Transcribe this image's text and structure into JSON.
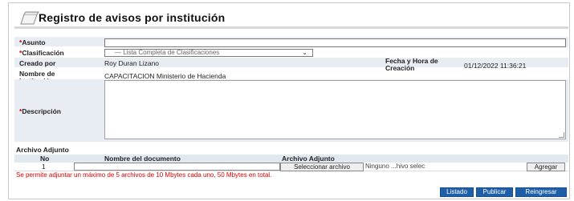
{
  "header": {
    "title": "Registro de avisos por institución"
  },
  "form": {
    "asunto_label": "Asunto",
    "clasificacion_label": "Clasificación",
    "clasificacion_selected": "— Lista Completa de Clasificaciones",
    "creado_label": "Creado por",
    "creado_value": "Roy Duran Lizano",
    "fecha_label": "Fecha y Hora de Creación",
    "fecha_value": "01/12/2022 11:36:21",
    "institucion_label": "Nombre de Institución",
    "institucion_value": "CAPACITACION Ministerio de Hacienda",
    "descripcion_label": "Descripción",
    "required_mark": "*"
  },
  "attachments": {
    "section_title": "Archivo Adjunto",
    "col_no": "No",
    "col_nombre": "Nombre del documento",
    "col_archivo": "Archivo Adjunto",
    "row_number": "1",
    "file_button": "Seleccionar archivo",
    "file_status": "Ninguno ...hivo selec",
    "add_button": "Agregar",
    "note": "Se permite adjuntar un máximo de 5 archivos de 10 Mbytes cada uno, 50 Mbytes en total."
  },
  "actions": {
    "listado": "Listado",
    "publicar": "Publicar",
    "reingresar": "Reingresar"
  },
  "colors": {
    "required": "#d40000",
    "primary_button": "#1f5fa8",
    "row_shade": "#e8edf3"
  }
}
